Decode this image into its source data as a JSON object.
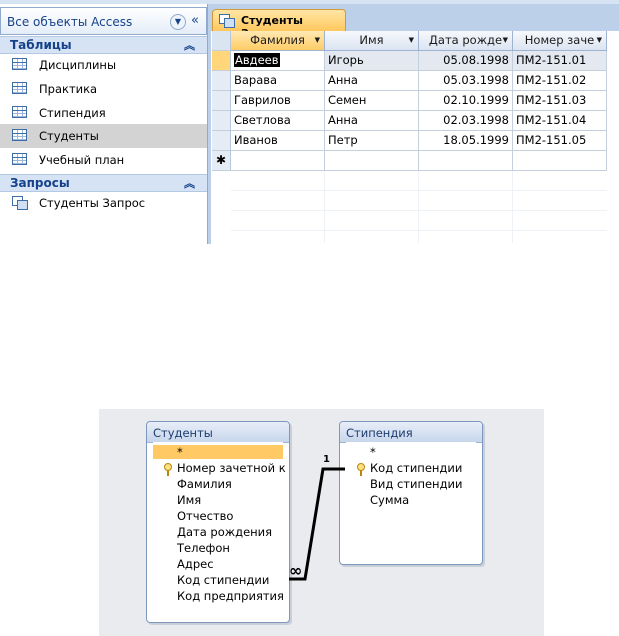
{
  "nav": {
    "title": "Все объекты Access",
    "groups": [
      {
        "label": "Таблицы",
        "items": [
          "Дисциплины",
          "Практика",
          "Стипендия",
          "Студенты",
          "Учебный план"
        ]
      },
      {
        "label": "Запросы",
        "items": [
          "Студенты Запрос"
        ]
      }
    ],
    "selected_item": "Студенты"
  },
  "document_tab": {
    "label": "Студенты Запрос"
  },
  "datasheet": {
    "columns": [
      "Фамилия",
      "Имя",
      "Дата рожде",
      "Номер заче"
    ],
    "rows": [
      [
        "Авдеев",
        "Игорь",
        "05.08.1998",
        "ПМ2-151.01"
      ],
      [
        "Варава",
        "Анна",
        "05.03.1998",
        "ПМ2-151.02"
      ],
      [
        "Гаврилов",
        "Семен",
        "02.10.1999",
        "ПМ2-151.03"
      ],
      [
        "Светлова",
        "Анна",
        "02.03.1998",
        "ПМ2-151.04"
      ],
      [
        "Иванов",
        "Петр",
        "18.05.1999",
        "ПМ2-151.05"
      ]
    ],
    "new_row_marker": "✱"
  },
  "relationships": {
    "tables": [
      {
        "title": "Студенты",
        "fields": [
          "*",
          "Номер зачетной к",
          "Фамилия",
          "Имя",
          "Отчество",
          "Дата рождения",
          "Телефон",
          "Адрес",
          "Код стипендии",
          "Код предприятия"
        ]
      },
      {
        "title": "Стипендия",
        "fields": [
          "*",
          "Код стипендии",
          "Вид стипендии",
          "Сумма"
        ]
      }
    ],
    "link": {
      "one_label": "1",
      "many_label": "∞"
    }
  },
  "colors": {
    "accent_tab": "#ffc65a",
    "nav_header": "#15428b",
    "selection": "#d3d3d3"
  }
}
